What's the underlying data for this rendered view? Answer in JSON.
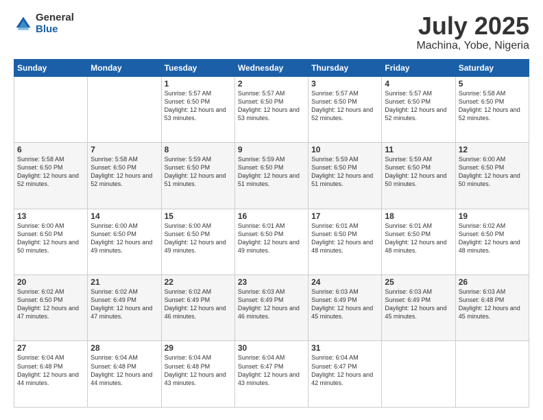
{
  "logo": {
    "general": "General",
    "blue": "Blue"
  },
  "header": {
    "title": "July 2025",
    "subtitle": "Machina, Yobe, Nigeria"
  },
  "days_of_week": [
    "Sunday",
    "Monday",
    "Tuesday",
    "Wednesday",
    "Thursday",
    "Friday",
    "Saturday"
  ],
  "weeks": [
    [
      {
        "day": "",
        "info": ""
      },
      {
        "day": "",
        "info": ""
      },
      {
        "day": "1",
        "info": "Sunrise: 5:57 AM\nSunset: 6:50 PM\nDaylight: 12 hours and 53 minutes."
      },
      {
        "day": "2",
        "info": "Sunrise: 5:57 AM\nSunset: 6:50 PM\nDaylight: 12 hours and 53 minutes."
      },
      {
        "day": "3",
        "info": "Sunrise: 5:57 AM\nSunset: 6:50 PM\nDaylight: 12 hours and 52 minutes."
      },
      {
        "day": "4",
        "info": "Sunrise: 5:57 AM\nSunset: 6:50 PM\nDaylight: 12 hours and 52 minutes."
      },
      {
        "day": "5",
        "info": "Sunrise: 5:58 AM\nSunset: 6:50 PM\nDaylight: 12 hours and 52 minutes."
      }
    ],
    [
      {
        "day": "6",
        "info": "Sunrise: 5:58 AM\nSunset: 6:50 PM\nDaylight: 12 hours and 52 minutes."
      },
      {
        "day": "7",
        "info": "Sunrise: 5:58 AM\nSunset: 6:50 PM\nDaylight: 12 hours and 52 minutes."
      },
      {
        "day": "8",
        "info": "Sunrise: 5:59 AM\nSunset: 6:50 PM\nDaylight: 12 hours and 51 minutes."
      },
      {
        "day": "9",
        "info": "Sunrise: 5:59 AM\nSunset: 6:50 PM\nDaylight: 12 hours and 51 minutes."
      },
      {
        "day": "10",
        "info": "Sunrise: 5:59 AM\nSunset: 6:50 PM\nDaylight: 12 hours and 51 minutes."
      },
      {
        "day": "11",
        "info": "Sunrise: 5:59 AM\nSunset: 6:50 PM\nDaylight: 12 hours and 50 minutes."
      },
      {
        "day": "12",
        "info": "Sunrise: 6:00 AM\nSunset: 6:50 PM\nDaylight: 12 hours and 50 minutes."
      }
    ],
    [
      {
        "day": "13",
        "info": "Sunrise: 6:00 AM\nSunset: 6:50 PM\nDaylight: 12 hours and 50 minutes."
      },
      {
        "day": "14",
        "info": "Sunrise: 6:00 AM\nSunset: 6:50 PM\nDaylight: 12 hours and 49 minutes."
      },
      {
        "day": "15",
        "info": "Sunrise: 6:00 AM\nSunset: 6:50 PM\nDaylight: 12 hours and 49 minutes."
      },
      {
        "day": "16",
        "info": "Sunrise: 6:01 AM\nSunset: 6:50 PM\nDaylight: 12 hours and 49 minutes."
      },
      {
        "day": "17",
        "info": "Sunrise: 6:01 AM\nSunset: 6:50 PM\nDaylight: 12 hours and 48 minutes."
      },
      {
        "day": "18",
        "info": "Sunrise: 6:01 AM\nSunset: 6:50 PM\nDaylight: 12 hours and 48 minutes."
      },
      {
        "day": "19",
        "info": "Sunrise: 6:02 AM\nSunset: 6:50 PM\nDaylight: 12 hours and 48 minutes."
      }
    ],
    [
      {
        "day": "20",
        "info": "Sunrise: 6:02 AM\nSunset: 6:50 PM\nDaylight: 12 hours and 47 minutes."
      },
      {
        "day": "21",
        "info": "Sunrise: 6:02 AM\nSunset: 6:49 PM\nDaylight: 12 hours and 47 minutes."
      },
      {
        "day": "22",
        "info": "Sunrise: 6:02 AM\nSunset: 6:49 PM\nDaylight: 12 hours and 46 minutes."
      },
      {
        "day": "23",
        "info": "Sunrise: 6:03 AM\nSunset: 6:49 PM\nDaylight: 12 hours and 46 minutes."
      },
      {
        "day": "24",
        "info": "Sunrise: 6:03 AM\nSunset: 6:49 PM\nDaylight: 12 hours and 45 minutes."
      },
      {
        "day": "25",
        "info": "Sunrise: 6:03 AM\nSunset: 6:49 PM\nDaylight: 12 hours and 45 minutes."
      },
      {
        "day": "26",
        "info": "Sunrise: 6:03 AM\nSunset: 6:48 PM\nDaylight: 12 hours and 45 minutes."
      }
    ],
    [
      {
        "day": "27",
        "info": "Sunrise: 6:04 AM\nSunset: 6:48 PM\nDaylight: 12 hours and 44 minutes."
      },
      {
        "day": "28",
        "info": "Sunrise: 6:04 AM\nSunset: 6:48 PM\nDaylight: 12 hours and 44 minutes."
      },
      {
        "day": "29",
        "info": "Sunrise: 6:04 AM\nSunset: 6:48 PM\nDaylight: 12 hours and 43 minutes."
      },
      {
        "day": "30",
        "info": "Sunrise: 6:04 AM\nSunset: 6:47 PM\nDaylight: 12 hours and 43 minutes."
      },
      {
        "day": "31",
        "info": "Sunrise: 6:04 AM\nSunset: 6:47 PM\nDaylight: 12 hours and 42 minutes."
      },
      {
        "day": "",
        "info": ""
      },
      {
        "day": "",
        "info": ""
      }
    ]
  ]
}
